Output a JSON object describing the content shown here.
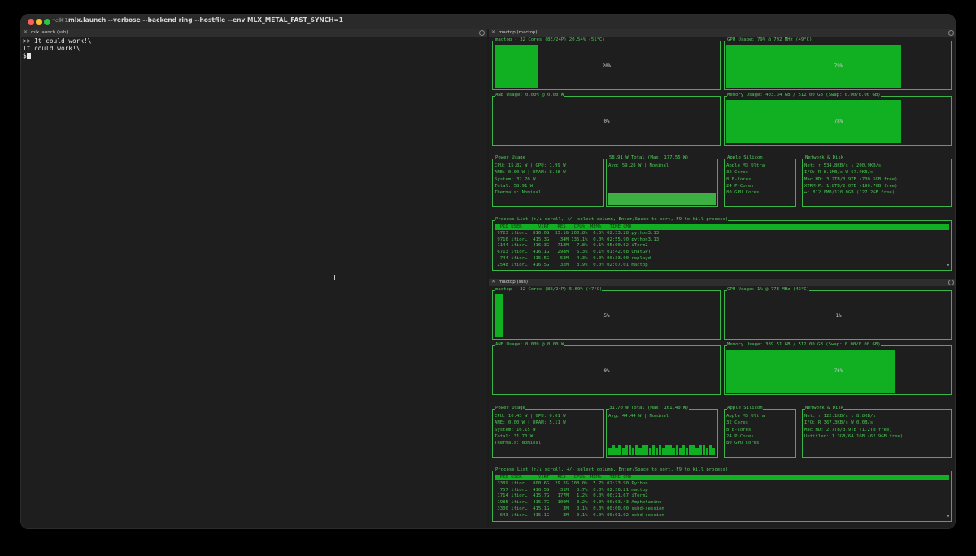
{
  "window": {
    "shortcut": "⌥⌘1",
    "title": "mlx.launch --verbose --backend ring --hostfile  --env MLX_METAL_FAST_SYNCH=1"
  },
  "left_tab": {
    "label": "mlx.launch (ssh)"
  },
  "terminal": {
    "lines": [
      ">> It could work!\\",
      "It could work!\\",
      "$"
    ]
  },
  "panes": [
    {
      "tab": "mactop (mactop)",
      "cpu": {
        "title": "mactop - 32 Cores (8E/24P) 20.54% (51°C)",
        "pct": "20%",
        "value": 0.205
      },
      "gpu": {
        "title": "GPU Usage: 79% @ 792 MHz (49°C)",
        "pct": "79%",
        "value": 0.79
      },
      "ane": {
        "title": "ANE Usage: 0.00% @ 0.00 W",
        "pct": "0%"
      },
      "mem": {
        "title": "Memory Usage: 403.34 GB / 512.00 GB (Swap: 0.00/0.00 GB)",
        "pct": "78%",
        "value": 0.78
      },
      "power": {
        "title": "Power Usage",
        "lines": [
          "CPU: 15.82 W | GPU: 1.99 W",
          "ANE: 0.00 W | DRAM: 8.48 W",
          "System: 32.70 W",
          "Total: 58.91 W",
          "Thermals: Nominal"
        ]
      },
      "total": {
        "title": "58.91 W Total (Max: 177.55 W)",
        "lines": [
          "Avg: 59.28 W | Nominal"
        ]
      },
      "silicon": {
        "title": "Apple Silicon",
        "lines": [
          "Apple M3 Ultra",
          "32 Cores",
          "8 E-Cores",
          "24 P-Cores",
          "80 GPU Cores"
        ]
      },
      "net": {
        "title": "Network & Disk",
        "lines": [
          "Net: ↑ 534.8KB/s ↓ 200.9KB/s",
          "I/O: R 8.1MB/s W 67.9KB/s",
          "Mac HD: 3.2TB/3.9TB (700.5GB free)",
          "XTRM-P: 1.8TB/2.0TB (190.7GB free)",
          "↔: 812.0MB/128.0GB (127.2GB free)"
        ]
      },
      "proc": {
        "title": "Process List (↑/↓ scroll, +/- select column, Enter/Space to sort, F9 to kill process)",
        "header": "  PID USER      VIRT   RES   CPU%  MEM%   TIME CMD",
        "rows": [
          " 9723 ifior…  816.0G  33.1G 200.8%  6.5% 02:33.28 python3.13",
          " 9716 ifior…  415.3G    34M 135.1%  0.0% 02:55.90 python3.13",
          " 1144 ifior…  416.3G   718M   7.8%  0.1% 05:00.62 iTerm2",
          " 6713 ifior…  416.1G   298M   5.3%  0.1% 01:42.68 ChatGPT",
          "  744 ifior…  415.5G    52M   4.3%  0.0% 00:33.00 replayd",
          " 2548 ifior…  416.5G    32M   3.9%  0.0% 02:07.01 mactop"
        ]
      }
    },
    {
      "tab": "mactop (ssh)",
      "cpu": {
        "title": "mactop - 32 Cores (8E/24P) 5.69% (47°C)",
        "pct": "5%",
        "value": 0.057
      },
      "gpu": {
        "title": "GPU Usage: 1% @ 778 MHz (43°C)",
        "pct": "1%",
        "value": 0.01
      },
      "ane": {
        "title": "ANE Usage: 0.00% @ 0.00 W",
        "pct": "0%"
      },
      "mem": {
        "title": "Memory Usage: 389.51 GB / 512.00 GB (Swap: 0.00/0.00 GB)",
        "pct": "76%",
        "value": 0.76
      },
      "power": {
        "title": "Power Usage",
        "lines": [
          "CPU: 10.43 W | GPU: 0.01 W",
          "ANE: 0.00 W | DRAM: 5.11 W",
          "System: 16.15 W",
          "Total: 31.70 W",
          "Thermals: Nominal"
        ]
      },
      "total": {
        "title": "31.70 W Total (Max: 161.40 W)",
        "lines": [
          "Avg: 44.44 W | Nominal"
        ]
      },
      "silicon": {
        "title": "Apple Silicon",
        "lines": [
          "Apple M3 Ultra",
          "32 Cores",
          "8 E-Cores",
          "24 P-Cores",
          "80 GPU Cores"
        ]
      },
      "net": {
        "title": "Network & Disk",
        "lines": [
          "Net: ↑ 122.1KB/s ↓ 8.8KB/s",
          "I/O: R 367.3KB/s W 0.0B/s",
          "Mac HD: 2.7TB/3.9TB (1.2TB free)",
          "Untitled: 1.3GB/64.1GB (62.9GB free)"
        ]
      },
      "proc": {
        "title": "Process List (↑/↓ scroll, +/- select column, Enter/Space to sort, F9 to kill process)",
        "header": "  PID USER      VIRT   RES   CPU%  MEM%   TIME CMD",
        "rows": [
          " 3389 ifior…  800.6G  29.2G 103.0%  5.7% 02:23.90 Python",
          "  757 ifior…  416.5G    31M   8.7%  0.0% 02:36.21 mactop",
          " 1714 ifior…  415.7G   177M   1.2%  0.0% 00:21.67 iTerm2",
          " 1985 ifior…  415.7G   100M   0.2%  0.0% 00:03.43 Amphetamine",
          " 3300 ifior…  415.1G     3M   0.1%  0.0% 00:00.00 sshd-session",
          "  643 ifior…  415.1G     3M   0.1%  0.0% 00:01.02 sshd-session"
        ]
      }
    }
  ],
  "colors": {
    "accent": "#10b022",
    "border": "#3bb54a",
    "text": "#49c552"
  },
  "icons": {
    "close": "close-icon",
    "cursor": "ibeam-cursor-icon",
    "scroll": "scroll-down-arrow-icon"
  }
}
